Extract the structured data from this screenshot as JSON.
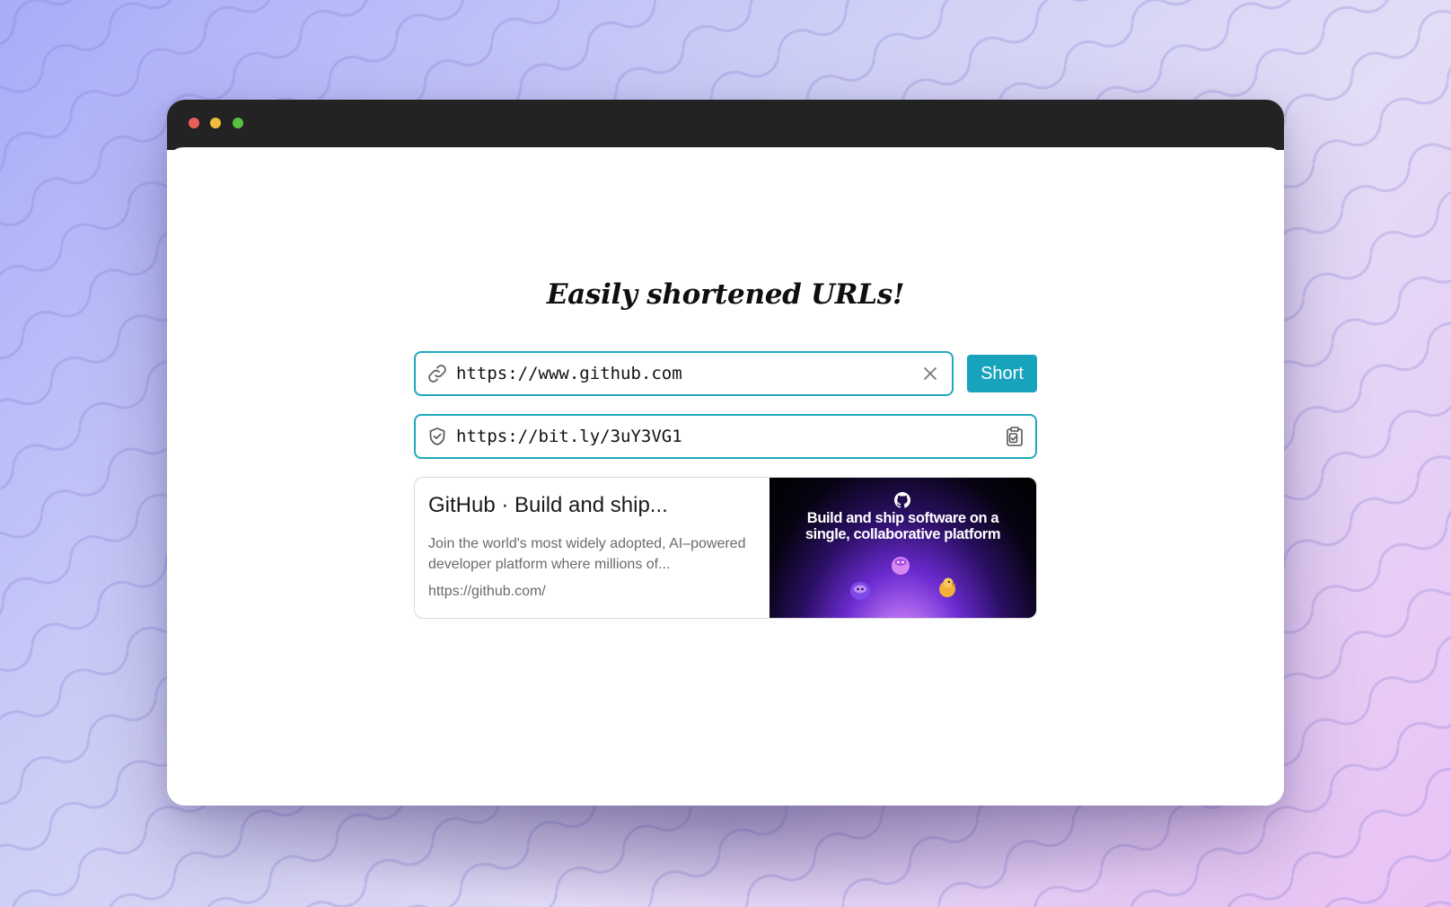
{
  "app": {
    "heading": "Easily shortened URLs!"
  },
  "url_input": {
    "value": "https://www.github.com",
    "icon": "link-icon",
    "clear_icon": "close-icon"
  },
  "short_button": {
    "label": "Short"
  },
  "result": {
    "value": "https://bit.ly/3uY3VG1",
    "icon": "shield-check-icon",
    "copy_icon": "clipboard-check-icon"
  },
  "preview": {
    "title": "GitHub · Build and ship...",
    "description": "Join the world's most widely adopted, AI–powered developer platform where millions of...",
    "url": "https://github.com/",
    "image_headline_line1": "Build and ship software on a",
    "image_headline_line2": "single, collaborative platform"
  },
  "colors": {
    "accent": "#18a3bd",
    "border": "#22a8be",
    "titlebar": "#232323"
  }
}
